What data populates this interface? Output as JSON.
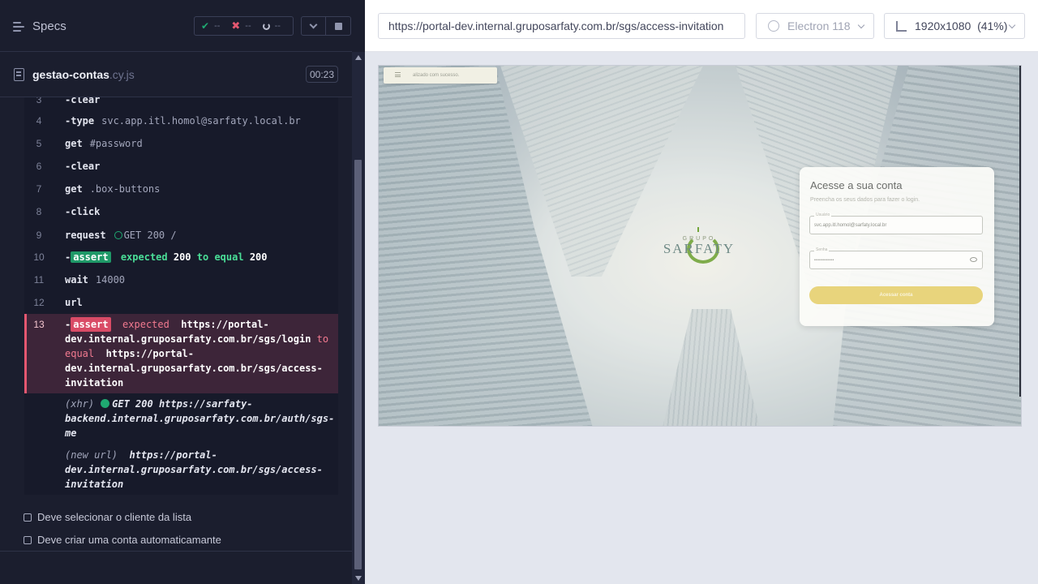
{
  "reporter": {
    "specs_label": "Specs",
    "stats": {
      "passed": "--",
      "failed": "--",
      "pending": "--"
    },
    "file": {
      "name": "gestao-contas",
      "ext": ".cy.js",
      "duration": "00:23"
    }
  },
  "log": {
    "rows": [
      {
        "line": "3",
        "cmd": "-clear",
        "arg": ""
      },
      {
        "line": "4",
        "cmd": "-type",
        "arg": "svc.app.itl.homol@sarfaty.local.br"
      },
      {
        "line": "5",
        "cmd": "get",
        "arg": "#password"
      },
      {
        "line": "6",
        "cmd": "-clear",
        "arg": ""
      },
      {
        "line": "7",
        "cmd": "get",
        "arg": ".box-buttons"
      },
      {
        "line": "8",
        "cmd": "-click",
        "arg": ""
      },
      {
        "line": "9",
        "cmd": "request",
        "arg": "GET 200 /"
      },
      {
        "line": "11",
        "cmd": "wait",
        "arg": "14000"
      },
      {
        "line": "12",
        "cmd": "url",
        "arg": ""
      }
    ],
    "assert_pass": {
      "line": "10",
      "prefix": "-",
      "badge": "assert",
      "word_expected": "expected",
      "value_expected": "200",
      "word_to_equal": "to equal",
      "value_actual": "200"
    },
    "assert_fail": {
      "line": "13",
      "prefix": "-",
      "badge": "assert",
      "word_expected": "expected",
      "value_expected": "https://portal-dev.internal.gruposarfaty.com.br/sgs/login",
      "word_to": "to",
      "word_equal": "equal",
      "value_actual": "https://portal-dev.internal.gruposarfaty.com.br/sgs/access-invitation"
    },
    "xhr": {
      "label": "(xhr)",
      "method": "GET 200",
      "url": "https://sarfaty-backend.internal.gruposarfaty.com.br/auth/sgs-me"
    },
    "new_url": {
      "label": "(new url)",
      "url": "https://portal-dev.internal.gruposarfaty.com.br/sgs/access-invitation"
    }
  },
  "tests": [
    "Deve selecionar o cliente da lista",
    "Deve criar uma conta automaticamante"
  ],
  "browser_bar": {
    "url": "https://portal-dev.internal.gruposarfaty.com.br/sgs/access-invitation",
    "browser": "Electron 118",
    "viewport": "1920x1080  (41%)"
  },
  "app": {
    "toast": "alizado com sucesso.",
    "logo_small": "GRUPO",
    "logo_big": "SARFATY",
    "card": {
      "title": "Acesse a sua conta",
      "subtitle": "Preencha os seus dados para fazer o login.",
      "user_label": "Usuário",
      "user_value": "svc.app.itl.homol@sarfaty.local.br",
      "password_label": "Senha",
      "password_value": "••••••••••••",
      "button": "Acessar conta"
    }
  },
  "colors": {
    "pass": "#1fa971",
    "fail": "#e45770",
    "assert_pass": "#1f9968",
    "assert_fail": "#d94b66",
    "login_button": "#e8d47c"
  }
}
